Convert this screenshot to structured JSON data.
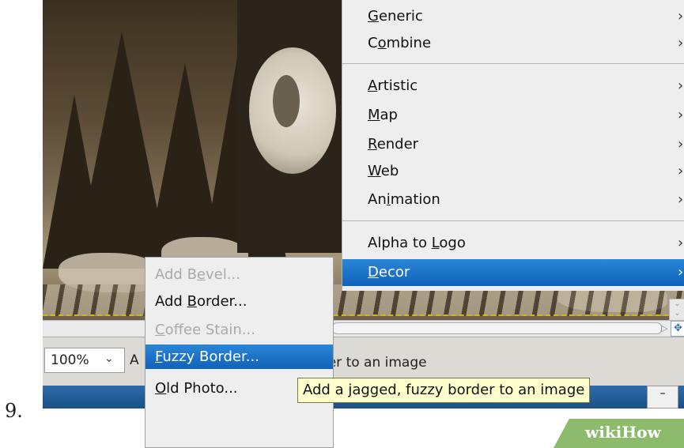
{
  "step": {
    "number": "9."
  },
  "menu": {
    "items": [
      {
        "pre": "",
        "key": "G",
        "post": "eneric",
        "arrow": "›"
      },
      {
        "pre": "C",
        "key": "o",
        "post": "mbine",
        "arrow": "›"
      },
      {
        "pre": "",
        "key": "A",
        "post": "rtistic",
        "arrow": "›"
      },
      {
        "pre": "",
        "key": "M",
        "post": "ap",
        "arrow": "›"
      },
      {
        "pre": "",
        "key": "R",
        "post": "ender",
        "arrow": "›"
      },
      {
        "pre": "",
        "key": "W",
        "post": "eb",
        "arrow": "›"
      },
      {
        "pre": "An",
        "key": "i",
        "post": "mation",
        "arrow": "›"
      },
      {
        "pre": "Alpha to ",
        "key": "L",
        "post": "ogo",
        "arrow": "›"
      },
      {
        "pre": "",
        "key": "D",
        "post": "ecor",
        "arrow": "›",
        "selected": true
      }
    ]
  },
  "submenu": {
    "items": [
      {
        "pre": "Add B",
        "key": "e",
        "post": "vel...",
        "disabled": true
      },
      {
        "pre": "Add ",
        "key": "B",
        "post": "order...",
        "disabled": false
      },
      {
        "pre": "",
        "key": "C",
        "post": "offee Stain...",
        "disabled": true
      },
      {
        "pre": "",
        "key": "F",
        "post": "uzzy Border...",
        "disabled": false,
        "selected": true
      },
      {
        "pre": "",
        "key": "O",
        "post": "ld Photo...",
        "disabled": false
      }
    ]
  },
  "tooltip": {
    "text": "Add a jagged, fuzzy border to an image"
  },
  "statusbar": {
    "zoom": "100%",
    "zoom_arrow": "⌄",
    "prefix": "A",
    "text": "ler to an image"
  },
  "icons": {
    "submenu_arrow": "chevron-right-icon",
    "zoom_dropdown": "chevron-down-icon",
    "navigate": "move-arrows-icon"
  },
  "colors": {
    "selection": "#0f62b8",
    "tooltip_bg": "#ffffcc",
    "menu_bg": "#eeeeee",
    "watermark": "#8bbb6b"
  },
  "watermark": {
    "text": "wikiHow"
  }
}
